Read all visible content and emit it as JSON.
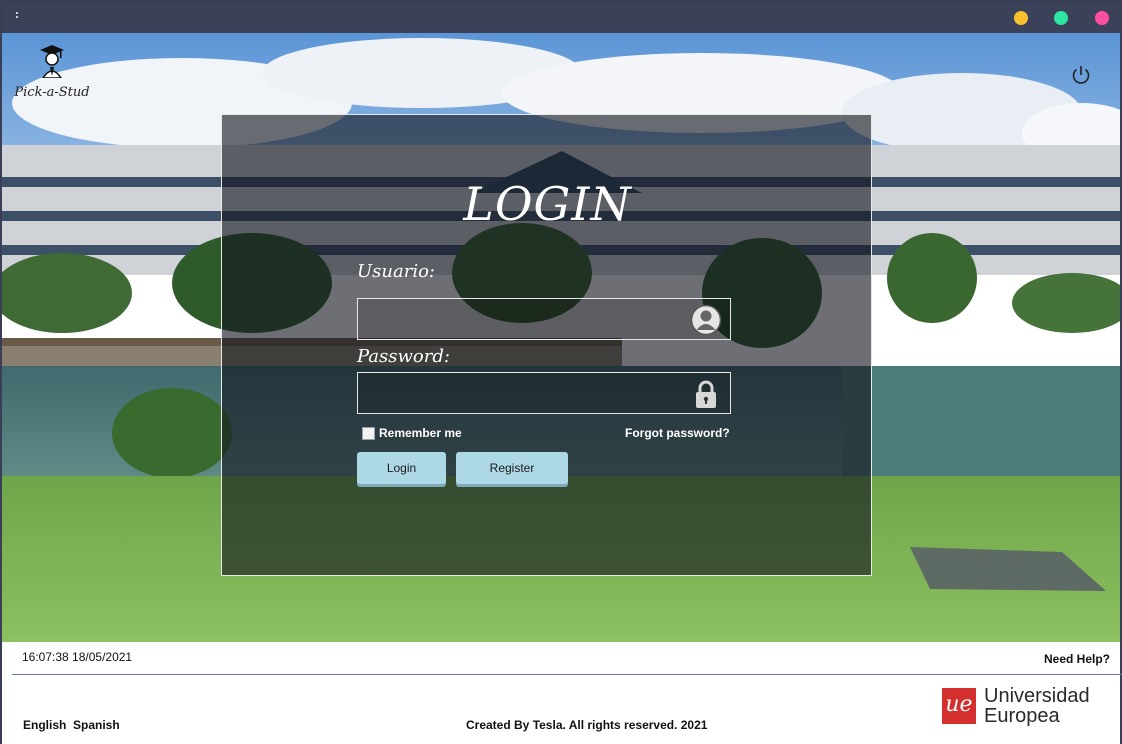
{
  "titlebar": {
    "dot_colors": [
      "#fbc02d",
      "#2ee6a0",
      "#ff4fa0"
    ]
  },
  "brand": {
    "name": "Pick-a-Stud"
  },
  "login": {
    "title": "LOGIN",
    "username_label": "Usuario:",
    "username_value": "",
    "password_label": "Password:",
    "password_value": "",
    "remember_label": "Remember me",
    "remember_checked": false,
    "forgot_label": "Forgot password?",
    "login_button": "Login",
    "register_button": "Register"
  },
  "footer": {
    "datetime": "16:07:38 18/05/2021",
    "help": "Need Help?",
    "lang_english": "English",
    "lang_spanish": "Spanish",
    "credits": "Created By Tesla. All rights reserved. 2021",
    "university_line1": "Universidad",
    "university_line2": "Europea",
    "university_mark": "ue"
  },
  "colors": {
    "titlebar": "#3b4159",
    "button": "#add8e6",
    "ue_red": "#d32f2f"
  }
}
